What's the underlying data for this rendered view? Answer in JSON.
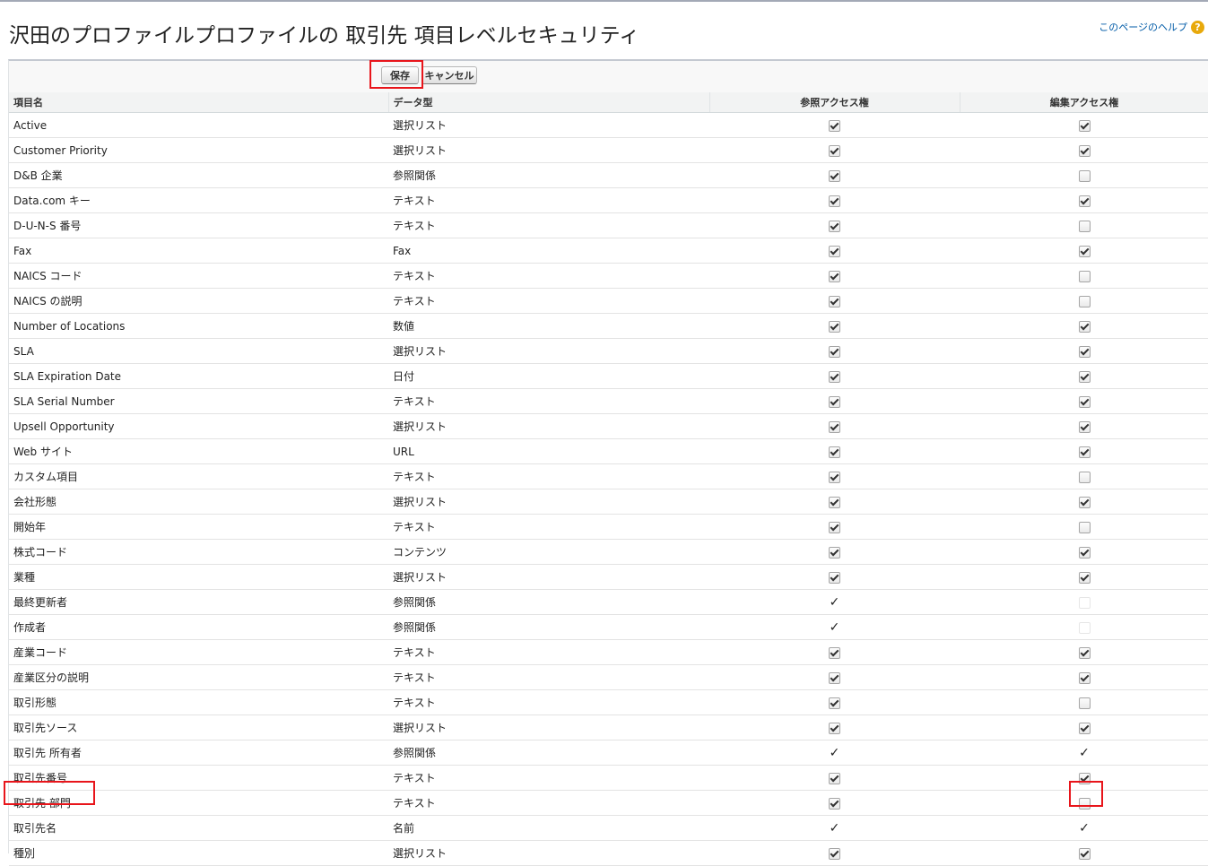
{
  "page": {
    "title": "沢田のプロファイルプロファイルの 取引先 項目レベルセキュリティ",
    "help_label": "このページのヘルプ",
    "help_icon": "question-icon"
  },
  "toolbar": {
    "save_label": "保存",
    "cancel_label": "キャンセル"
  },
  "columns": {
    "field": "項目名",
    "type": "データ型",
    "read": "参照アクセス権",
    "edit": "編集アクセス権"
  },
  "rows": [
    {
      "field": "Active",
      "type": "選択リスト",
      "read": "checked",
      "edit": "checked"
    },
    {
      "field": "Customer Priority",
      "type": "選択リスト",
      "read": "checked",
      "edit": "checked"
    },
    {
      "field": "D&B 企業",
      "type": "参照関係",
      "read": "checked",
      "edit": "unchecked"
    },
    {
      "field": "Data.com キー",
      "type": "テキスト",
      "read": "checked",
      "edit": "checked"
    },
    {
      "field": "D-U-N-S 番号",
      "type": "テキスト",
      "read": "checked",
      "edit": "unchecked"
    },
    {
      "field": "Fax",
      "type": "Fax",
      "read": "checked",
      "edit": "checked"
    },
    {
      "field": "NAICS コード",
      "type": "テキスト",
      "read": "checked",
      "edit": "unchecked"
    },
    {
      "field": "NAICS の説明",
      "type": "テキスト",
      "read": "checked",
      "edit": "unchecked"
    },
    {
      "field": "Number of Locations",
      "type": "数値",
      "read": "checked",
      "edit": "checked"
    },
    {
      "field": "SLA",
      "type": "選択リスト",
      "read": "checked",
      "edit": "checked"
    },
    {
      "field": "SLA Expiration Date",
      "type": "日付",
      "read": "checked",
      "edit": "checked"
    },
    {
      "field": "SLA Serial Number",
      "type": "テキスト",
      "read": "checked",
      "edit": "checked"
    },
    {
      "field": "Upsell Opportunity",
      "type": "選択リスト",
      "read": "checked",
      "edit": "checked"
    },
    {
      "field": "Web サイト",
      "type": "URL",
      "read": "checked",
      "edit": "checked"
    },
    {
      "field": "カスタム項目",
      "type": "テキスト",
      "read": "checked",
      "edit": "unchecked"
    },
    {
      "field": "会社形態",
      "type": "選択リスト",
      "read": "checked",
      "edit": "checked"
    },
    {
      "field": "開始年",
      "type": "テキスト",
      "read": "checked",
      "edit": "unchecked"
    },
    {
      "field": "株式コード",
      "type": "コンテンツ",
      "read": "checked",
      "edit": "checked"
    },
    {
      "field": "業種",
      "type": "選択リスト",
      "read": "checked",
      "edit": "checked"
    },
    {
      "field": "最終更新者",
      "type": "参照関係",
      "read": "tick",
      "edit": "disabled"
    },
    {
      "field": "作成者",
      "type": "参照関係",
      "read": "tick",
      "edit": "disabled"
    },
    {
      "field": "産業コード",
      "type": "テキスト",
      "read": "checked",
      "edit": "checked"
    },
    {
      "field": "産業区分の説明",
      "type": "テキスト",
      "read": "checked",
      "edit": "checked"
    },
    {
      "field": "取引形態",
      "type": "テキスト",
      "read": "checked",
      "edit": "unchecked"
    },
    {
      "field": "取引先ソース",
      "type": "選択リスト",
      "read": "checked",
      "edit": "checked"
    },
    {
      "field": "取引先 所有者",
      "type": "参照関係",
      "read": "tick",
      "edit": "tick"
    },
    {
      "field": "取引先番号",
      "type": "テキスト",
      "read": "checked",
      "edit": "checked"
    },
    {
      "field": "取引先 部門",
      "type": "テキスト",
      "read": "checked",
      "edit": "unchecked"
    },
    {
      "field": "取引先名",
      "type": "名前",
      "read": "tick",
      "edit": "tick"
    },
    {
      "field": "種別",
      "type": "選択リスト",
      "read": "checked",
      "edit": "checked"
    }
  ],
  "highlight_color": "#e8151b"
}
